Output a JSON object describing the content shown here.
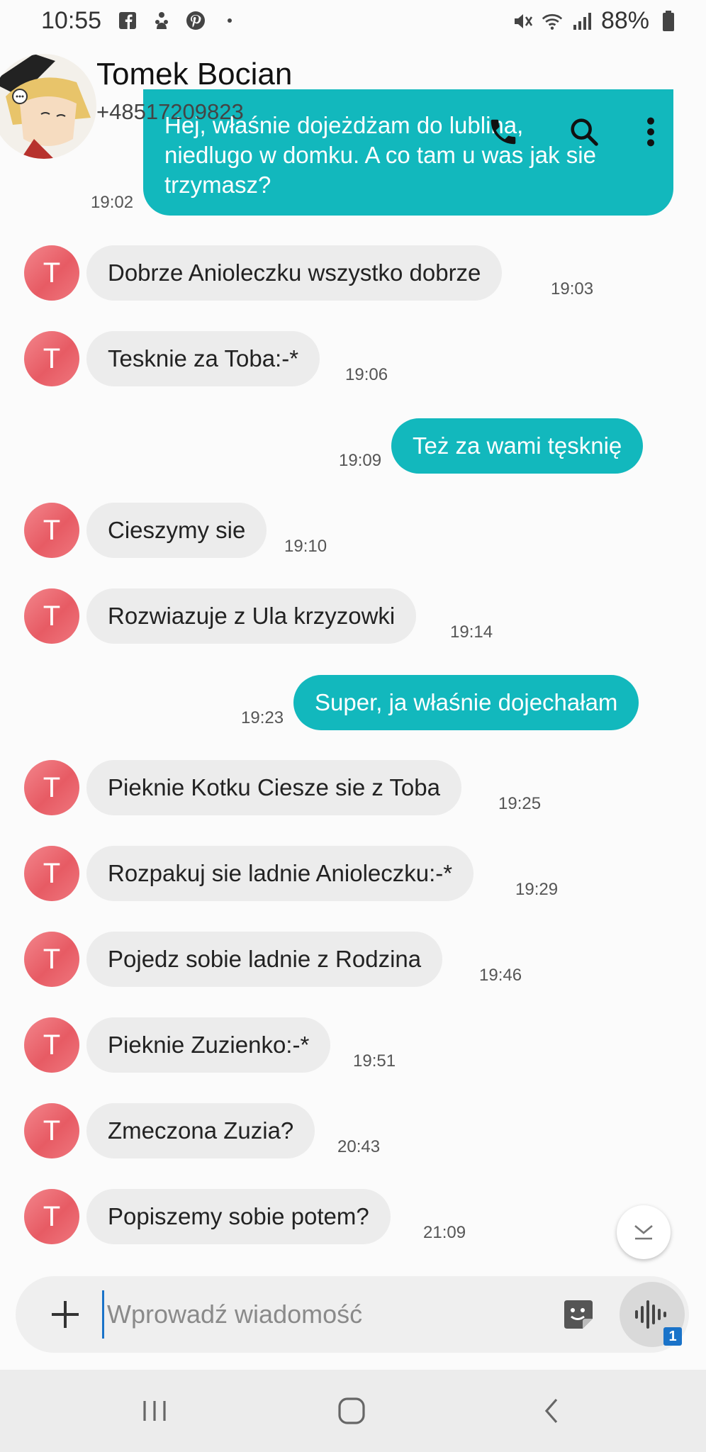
{
  "status_bar": {
    "time": "10:55",
    "battery": "88%"
  },
  "header": {
    "contact_name": "Tomek Bocian",
    "contact_number": "+48517209823"
  },
  "messages": [
    {
      "dir": "out",
      "text_line1": "Hej, właśnie dojeżdżam do lublina,",
      "text_line2": "niedlugo w domku. A co tam u was jak sie",
      "text_line3": "trzymasz?",
      "time": "19:02"
    },
    {
      "dir": "in",
      "avatar_letter": "T",
      "text": "Dobrze Anioleczku wszystko dobrze",
      "time": "19:03"
    },
    {
      "dir": "in",
      "avatar_letter": "T",
      "text": "Tesknie za Toba:-*",
      "time": "19:06"
    },
    {
      "dir": "out",
      "text": "Też za wami tęsknię",
      "time": "19:09"
    },
    {
      "dir": "in",
      "avatar_letter": "T",
      "text": "Cieszymy sie",
      "time": "19:10"
    },
    {
      "dir": "in",
      "avatar_letter": "T",
      "text": "Rozwiazuje z Ula krzyzowki",
      "time": "19:14"
    },
    {
      "dir": "out",
      "text": "Super, ja właśnie dojechałam",
      "time": "19:23"
    },
    {
      "dir": "in",
      "avatar_letter": "T",
      "text": "Pieknie Kotku Ciesze sie z Toba",
      "time": "19:25"
    },
    {
      "dir": "in",
      "avatar_letter": "T",
      "text": "Rozpakuj sie ladnie Anioleczku:-*",
      "time": "19:29"
    },
    {
      "dir": "in",
      "avatar_letter": "T",
      "text": "Pojedz sobie ladnie z Rodzina",
      "time": "19:46"
    },
    {
      "dir": "in",
      "avatar_letter": "T",
      "text": "Pieknie Zuzienko:-*",
      "time": "19:51"
    },
    {
      "dir": "in",
      "avatar_letter": "T",
      "text": "Zmeczona Zuzia?",
      "time": "20:43"
    },
    {
      "dir": "in",
      "avatar_letter": "T",
      "text": "Popiszemy sobie potem?",
      "time": "21:09"
    }
  ],
  "composer": {
    "placeholder": "Wprowadź wiadomość",
    "sim_badge": "1"
  },
  "colors": {
    "outgoing_bubble": "#12b8bd",
    "incoming_bubble": "#ececec",
    "avatar": "#ee6b73"
  }
}
